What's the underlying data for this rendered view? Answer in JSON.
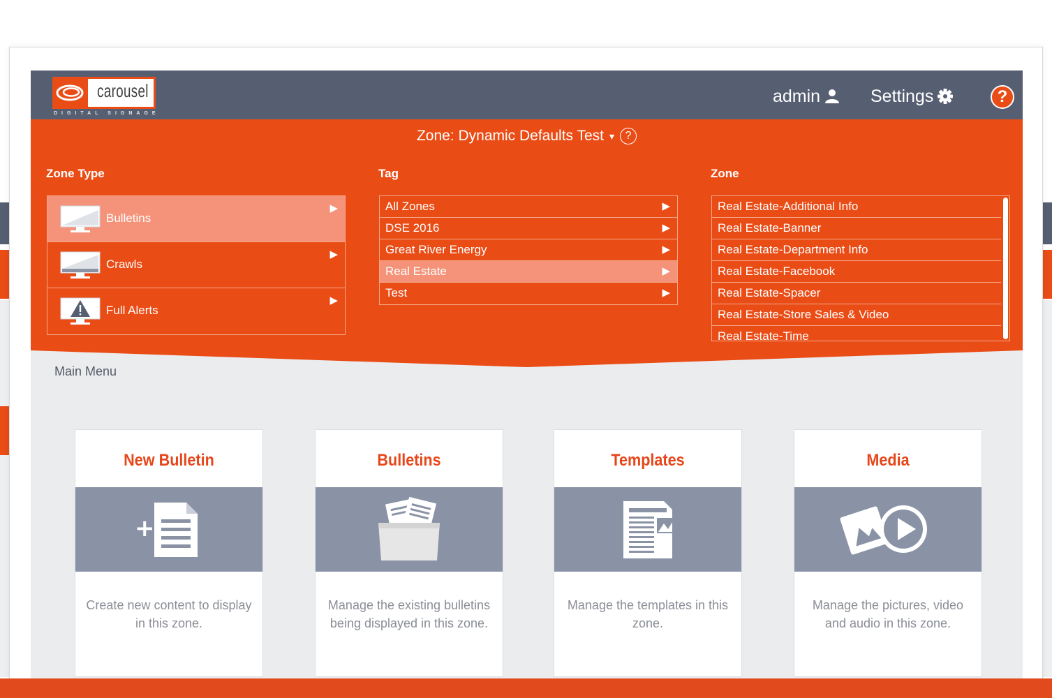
{
  "brand": {
    "logo_text": "carousel",
    "logo_tagline": "DIGITAL SIGNAGE",
    "accent_color": "#ea4c16",
    "header_color": "#565f72"
  },
  "header": {
    "admin_label": "admin",
    "settings_label": "Settings",
    "help_label": "?"
  },
  "zone_panel": {
    "title": "Zone: Dynamic Defaults Test",
    "help_label": "?",
    "zone_type_heading": "Zone Type",
    "tag_heading": "Tag",
    "zone_heading": "Zone",
    "zone_types": [
      {
        "label": "Bulletins",
        "icon": "monitor-icon",
        "selected": true
      },
      {
        "label": "Crawls",
        "icon": "monitor-crawl-icon",
        "selected": false
      },
      {
        "label": "Full Alerts",
        "icon": "monitor-alert-icon",
        "selected": false
      }
    ],
    "tags": [
      {
        "label": "All Zones",
        "selected": false
      },
      {
        "label": "DSE 2016",
        "selected": false
      },
      {
        "label": "Great River Energy",
        "selected": false
      },
      {
        "label": "Real Estate",
        "selected": true
      },
      {
        "label": "Test",
        "selected": false
      }
    ],
    "zones": [
      {
        "label": "Real Estate-Additional Info"
      },
      {
        "label": "Real Estate-Banner"
      },
      {
        "label": "Real Estate-Department Info"
      },
      {
        "label": "Real Estate-Facebook"
      },
      {
        "label": "Real Estate-Spacer"
      },
      {
        "label": "Real Estate-Store Sales & Video"
      },
      {
        "label": "Real Estate-Time"
      }
    ]
  },
  "main": {
    "menu_label": "Main Menu",
    "cards": [
      {
        "title": "New Bulletin",
        "icon": "new-document-icon",
        "description": "Create new content to display in this zone."
      },
      {
        "title": "Bulletins",
        "icon": "folder-documents-icon",
        "description": "Manage the existing bulletins being displayed in this zone."
      },
      {
        "title": "Templates",
        "icon": "template-icon",
        "description": "Manage the templates in this zone."
      },
      {
        "title": "Media",
        "icon": "media-play-icon",
        "description": "Manage the pictures, video and audio in this zone."
      }
    ]
  }
}
